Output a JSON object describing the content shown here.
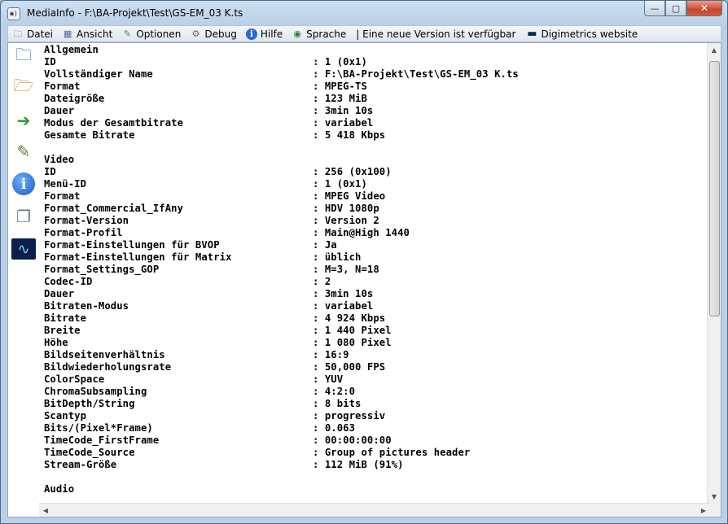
{
  "window": {
    "title": "MediaInfo - F:\\BA-Projekt\\Test\\GS-EM_03 K.ts",
    "app_icon": "mediainfo-icon"
  },
  "window_controls": {
    "minimize": "—",
    "maximize": "▢",
    "close": "✕"
  },
  "menu": {
    "items": [
      {
        "label": "Datei",
        "icon": "file-icon",
        "glyph": "🗀"
      },
      {
        "label": "Ansicht",
        "icon": "view-icon",
        "glyph": "▦"
      },
      {
        "label": "Optionen",
        "icon": "options-icon",
        "glyph": "✎"
      },
      {
        "label": "Debug",
        "icon": "debug-icon",
        "glyph": "⚙"
      },
      {
        "label": "Hilfe",
        "icon": "help-icon",
        "glyph": "ℹ"
      },
      {
        "label": "Sprache",
        "icon": "language-icon",
        "glyph": "◉"
      }
    ],
    "update_notice": "| Eine neue Version ist verfügbar",
    "website_label": "Digimetrics website",
    "website_glyph": "▬"
  },
  "sidebar": {
    "buttons": [
      {
        "name": "sidebar-open-file-button",
        "icon": "open-file-icon",
        "glyph": "🗀",
        "color": "#1f5fa8"
      },
      {
        "name": "sidebar-open-folder-button",
        "icon": "open-folder-icon",
        "glyph": "🗁",
        "color": "#c87a1a"
      },
      {
        "name": "sidebar-export-button",
        "icon": "export-icon",
        "glyph": "➔",
        "color": "#2a9a2a"
      },
      {
        "name": "sidebar-preferences-button",
        "icon": "preferences-icon",
        "glyph": "✎",
        "color": "#5a7a3a"
      },
      {
        "name": "sidebar-about-button",
        "icon": "info-icon",
        "glyph": "ℹ",
        "color": "#1a6ad0"
      },
      {
        "name": "sidebar-knowledge-button",
        "icon": "documents-icon",
        "glyph": "❐",
        "color": "#6a7a8a"
      },
      {
        "name": "sidebar-digimetrics-button",
        "icon": "waveform-icon",
        "glyph": "∿",
        "color": "#0a2a5a"
      }
    ]
  },
  "report": {
    "rows": [
      {
        "k": "Allgemein",
        "v": ""
      },
      {
        "k": "ID",
        "v": ": 1 (0x1)"
      },
      {
        "k": "Vollständiger Name",
        "v": ": F:\\BA-Projekt\\Test\\GS-EM_03 K.ts"
      },
      {
        "k": "Format",
        "v": ": MPEG-TS"
      },
      {
        "k": "Dateigröße",
        "v": ": 123 MiB"
      },
      {
        "k": "Dauer",
        "v": ": 3min 10s"
      },
      {
        "k": "Modus der Gesamtbitrate",
        "v": ": variabel"
      },
      {
        "k": "Gesamte Bitrate",
        "v": ": 5 418 Kbps"
      },
      {
        "k": "",
        "v": ""
      },
      {
        "k": "Video",
        "v": ""
      },
      {
        "k": "ID",
        "v": ": 256 (0x100)"
      },
      {
        "k": "Menü-ID",
        "v": ": 1 (0x1)"
      },
      {
        "k": "Format",
        "v": ": MPEG Video"
      },
      {
        "k": "Format_Commercial_IfAny",
        "v": ": HDV 1080p"
      },
      {
        "k": "Format-Version",
        "v": ": Version 2"
      },
      {
        "k": "Format-Profil",
        "v": ": Main@High 1440"
      },
      {
        "k": "Format-Einstellungen für BVOP",
        "v": ": Ja"
      },
      {
        "k": "Format-Einstellungen für Matrix",
        "v": ": üblich"
      },
      {
        "k": "Format_Settings_GOP",
        "v": ": M=3, N=18"
      },
      {
        "k": "Codec-ID",
        "v": ": 2"
      },
      {
        "k": "Dauer",
        "v": ": 3min 10s"
      },
      {
        "k": "Bitraten-Modus",
        "v": ": variabel"
      },
      {
        "k": "Bitrate",
        "v": ": 4 924 Kbps"
      },
      {
        "k": "Breite",
        "v": ": 1 440 Pixel"
      },
      {
        "k": "Höhe",
        "v": ": 1 080 Pixel"
      },
      {
        "k": "Bildseitenverhältnis",
        "v": ": 16:9"
      },
      {
        "k": "Bildwiederholungsrate",
        "v": ": 50,000 FPS"
      },
      {
        "k": "ColorSpace",
        "v": ": YUV"
      },
      {
        "k": "ChromaSubsampling",
        "v": ": 4:2:0"
      },
      {
        "k": "BitDepth/String",
        "v": ": 8 bits"
      },
      {
        "k": "Scantyp",
        "v": ": progressiv"
      },
      {
        "k": "Bits/(Pixel*Frame)",
        "v": ": 0.063"
      },
      {
        "k": "TimeCode_FirstFrame",
        "v": ": 00:00:00:00"
      },
      {
        "k": "TimeCode_Source",
        "v": ": Group of pictures header"
      },
      {
        "k": "Stream-Größe",
        "v": ": 112 MiB (91%)"
      },
      {
        "k": "",
        "v": ""
      },
      {
        "k": "Audio",
        "v": ""
      }
    ]
  },
  "scrollbars": {
    "up": "▲",
    "down": "▼",
    "left": "◀",
    "right": "▶"
  }
}
